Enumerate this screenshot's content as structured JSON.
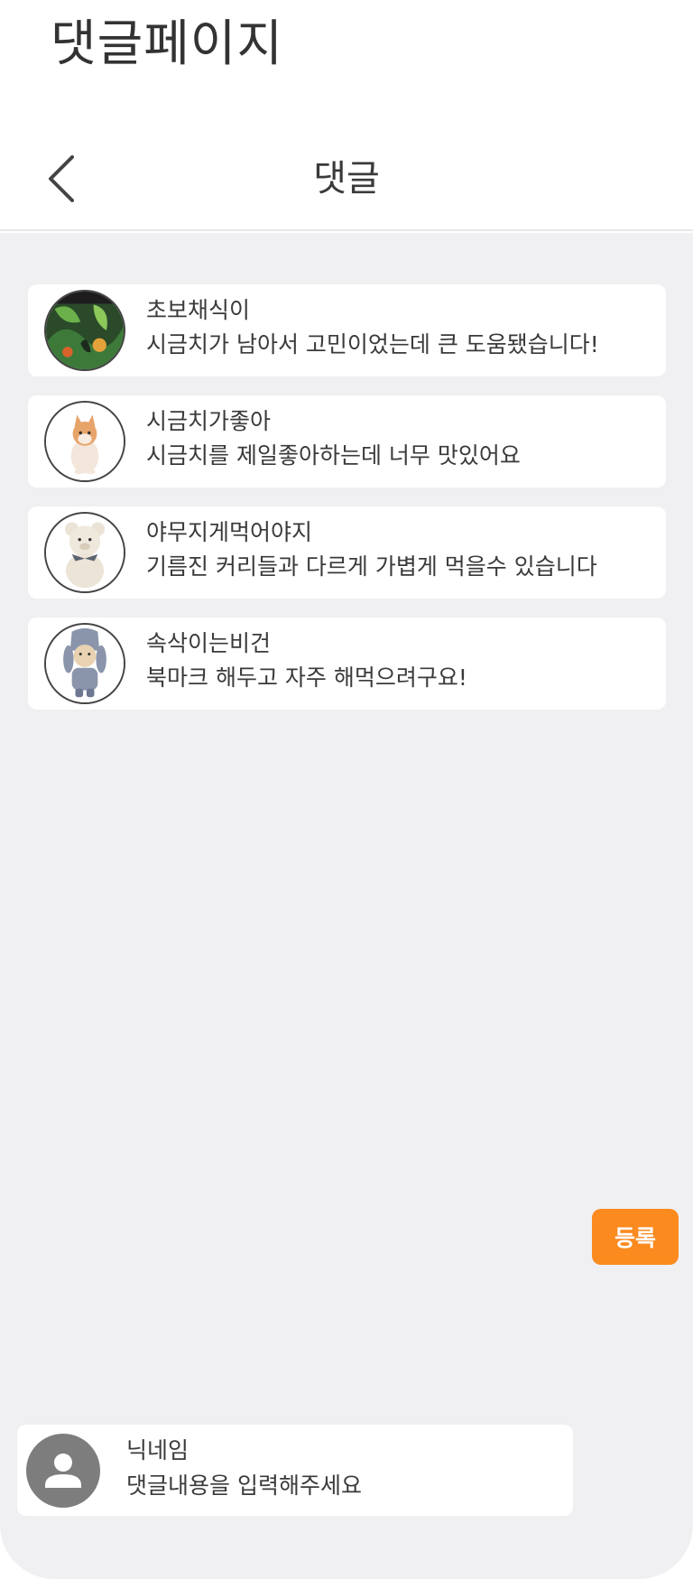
{
  "page": {
    "title": "댓글페이지"
  },
  "header": {
    "back_icon": "chevron-left-icon",
    "title": "댓글"
  },
  "comments": [
    {
      "nickname": "초보채식이",
      "text": "시금치가 남아서 고민이었는데 큰 도움됐습니다!",
      "avatar_icon": "jungle-painting-avatar"
    },
    {
      "nickname": "시금치가좋아",
      "text": "시금치를 제일좋아하는데 너무 맛있어요",
      "avatar_icon": "kitten-avatar"
    },
    {
      "nickname": "야무지게먹어야지",
      "text": "기름진 커리들과 다르게 가볍게 먹을수 있습니다",
      "avatar_icon": "teddy-bear-avatar"
    },
    {
      "nickname": "속삭이는비건",
      "text": "북마크 해두고 자주 해먹으려구요!",
      "avatar_icon": "bunny-plush-avatar"
    }
  ],
  "composer": {
    "avatar_icon": "user-icon",
    "nickname": "닉네임",
    "placeholder": "댓글내용을 입력해주세요",
    "value": "",
    "submit_label": "등록"
  },
  "colors": {
    "accent": "#fb8a1f",
    "background": "#f0f0f3",
    "card": "#ffffff",
    "text": "#3a3a3a"
  }
}
